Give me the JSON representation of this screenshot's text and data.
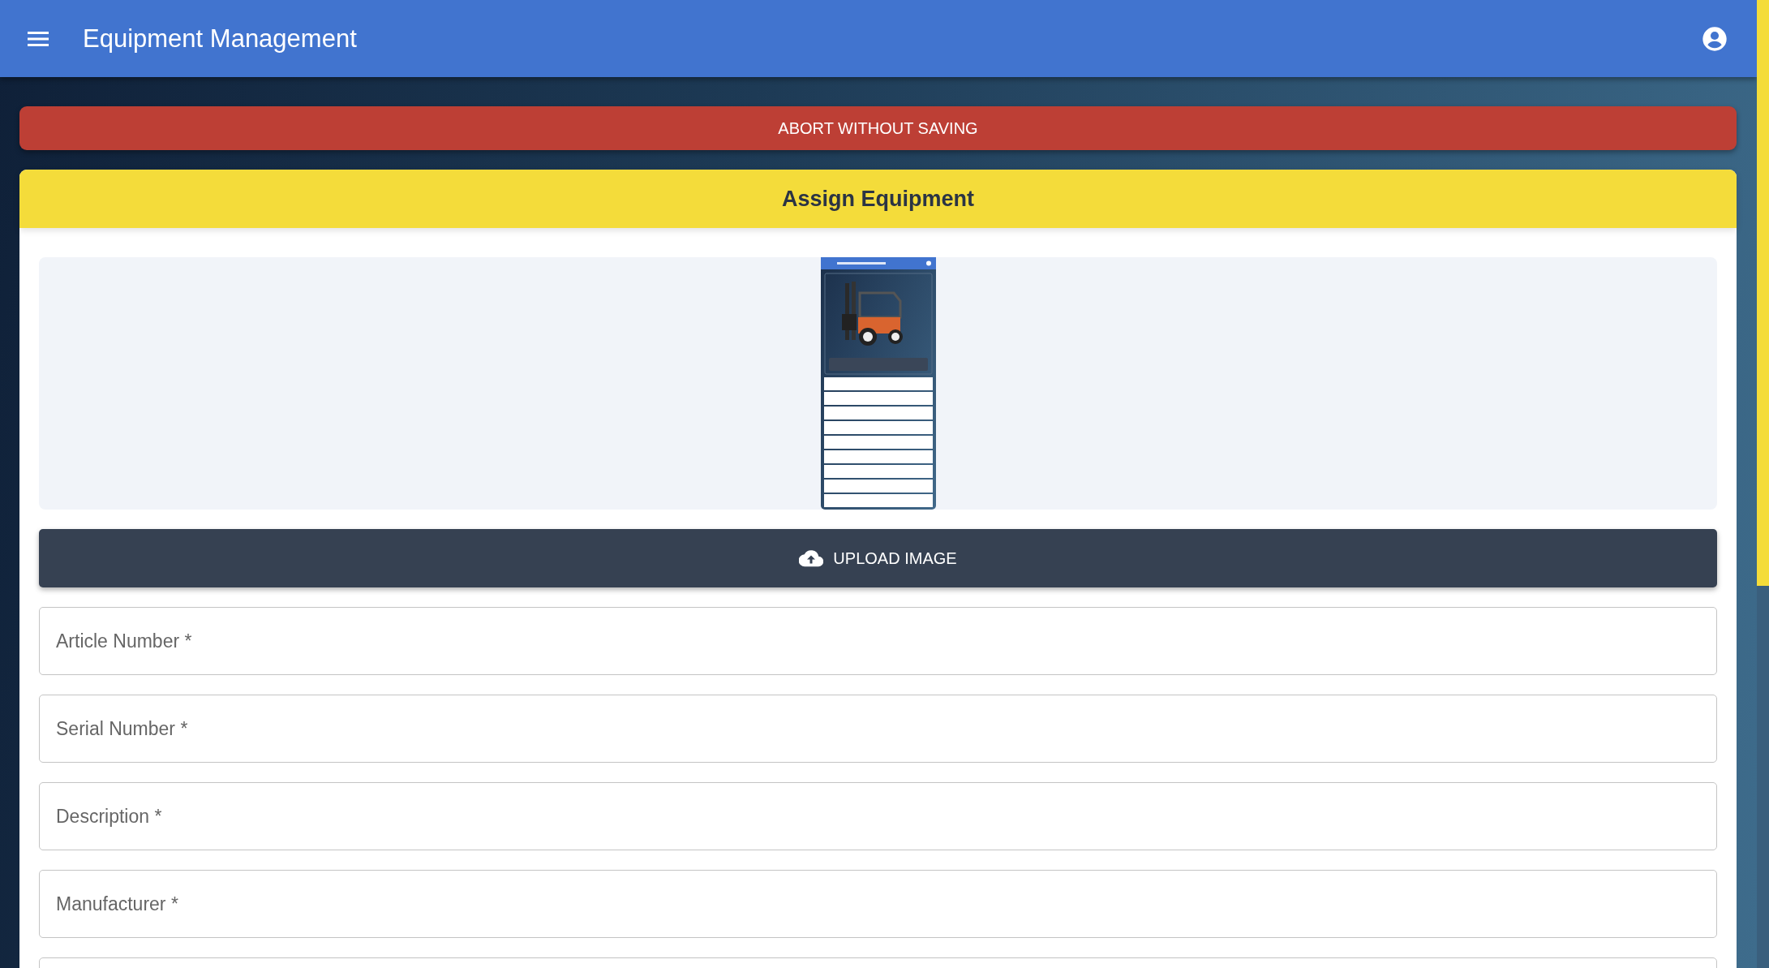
{
  "header": {
    "title": "Equipment Management"
  },
  "abort_button": {
    "label": "ABORT WITHOUT SAVING"
  },
  "card": {
    "title": "Assign Equipment"
  },
  "upload_button": {
    "label": "UPLOAD IMAGE"
  },
  "fields": [
    {
      "placeholder": "Article Number *"
    },
    {
      "placeholder": "Serial Number *"
    },
    {
      "placeholder": "Description *"
    },
    {
      "placeholder": "Manufacturer *"
    }
  ]
}
